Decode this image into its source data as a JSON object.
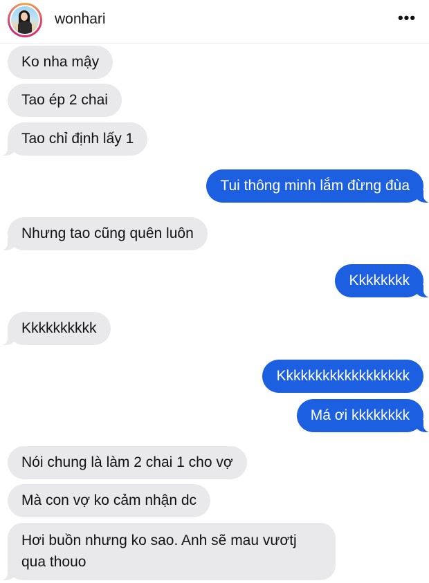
{
  "header": {
    "username": "wonhari",
    "more_label": "•••"
  },
  "messages": [
    {
      "side": "recv",
      "text": "Ko nha mậy"
    },
    {
      "side": "recv",
      "text": "Tao ép 2 chai"
    },
    {
      "side": "recv",
      "text": "Tao chỉ định lấy 1"
    },
    {
      "side": "sent",
      "text": "Tui thông minh lắm đừng đùa"
    },
    {
      "side": "recv",
      "text": "Nhưng tao cũng quên luôn"
    },
    {
      "side": "sent",
      "text": "Kkkkkkkk"
    },
    {
      "side": "recv",
      "text": "Kkkkkkkkkk"
    },
    {
      "side": "sent",
      "text": "Kkkkkkkkkkkkkkkkkk"
    },
    {
      "side": "sent",
      "text": "Má ơi kkkkkkkk"
    },
    {
      "side": "recv",
      "text": "Nói chung là làm 2 chai 1 cho vợ"
    },
    {
      "side": "recv",
      "text": "Mà con vợ ko cảm nhận dc"
    },
    {
      "side": "recv",
      "text": "Hơi buồn nhưng ko sao. Anh sẽ mau vươtj qua thouo"
    }
  ],
  "colors": {
    "sent_bubble": "#1c5fe0",
    "received_bubble": "#e9e9eb"
  }
}
